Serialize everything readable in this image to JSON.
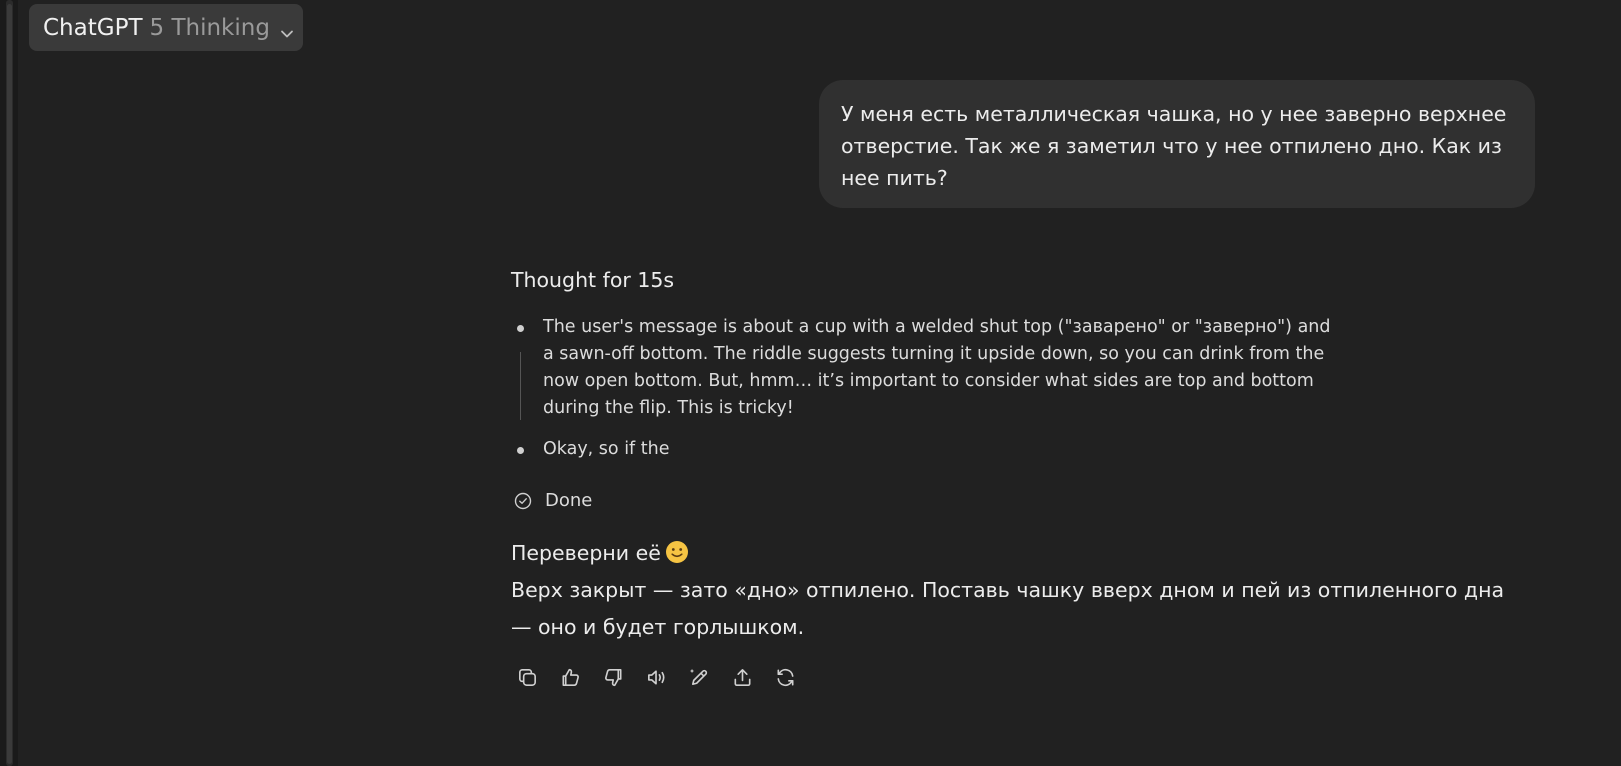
{
  "header": {
    "brand": "ChatGPT",
    "model_variant": "5 Thinking",
    "chevron_icon": "chevron-down-icon"
  },
  "conversation": {
    "user_message": "У меня есть металлическая чашка, но у нее заверно верхнее отверстие. Так же я заметил что у нее отпилено дно. Как из нее пить?",
    "thinking": {
      "header": "Thought for 15s",
      "steps": [
        "The user's message is about a cup with a welded shut top (\"заварено\" or \"заверно\") and a sawn-off bottom. The riddle suggests turning it upside down, so you can drink from the now open bottom. But, hmm… it’s important to consider what sides are top and bottom during the flip. This is tricky!",
        "Okay, so if the"
      ],
      "status": "Done"
    },
    "assistant_reply": {
      "line1": "Переверни её",
      "line1_emoji": "slightly-smiling-face",
      "line2": "Верх закрыт — зато «дно» отпилено. Поставь чашку вверх дном и пей из отпиленного дна — оно и будет горлышком."
    }
  },
  "actions": [
    {
      "icon": "copy-icon"
    },
    {
      "icon": "thumbs-up-icon"
    },
    {
      "icon": "thumbs-down-icon"
    },
    {
      "icon": "read-aloud-icon"
    },
    {
      "icon": "edit-canvas-icon"
    },
    {
      "icon": "share-icon"
    },
    {
      "icon": "regenerate-icon"
    }
  ],
  "colors": {
    "background": "#212121",
    "user_bubble": "#303030",
    "model_switch_bg": "#3a3a3a",
    "text": "#ececec",
    "muted": "#9a9a9a"
  }
}
